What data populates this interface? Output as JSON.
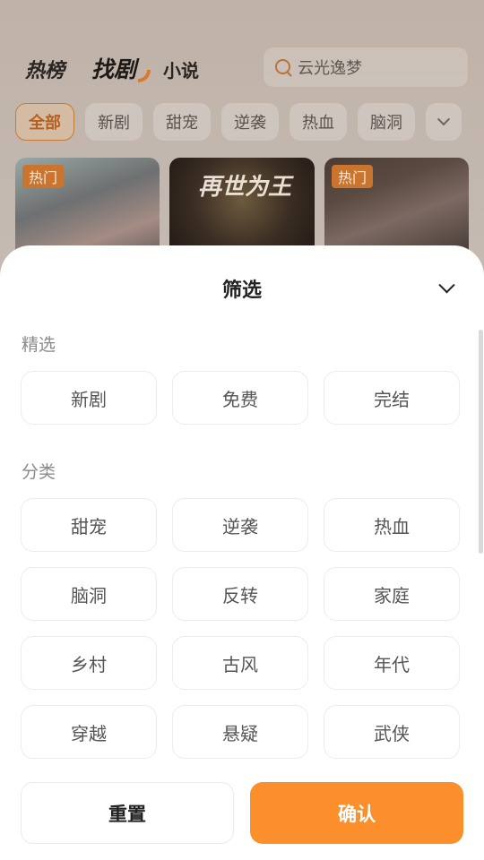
{
  "header": {
    "tabs": [
      {
        "label": "热榜"
      },
      {
        "label": "找剧"
      },
      {
        "label": "小说"
      }
    ],
    "search": {
      "placeholder": "云光逸梦"
    }
  },
  "category_chips": [
    "全部",
    "新剧",
    "甜宠",
    "逆袭",
    "热血",
    "脑洞"
  ],
  "cards": [
    {
      "badge": "热门"
    },
    {
      "title": "再世为王"
    },
    {
      "badge": "热门"
    }
  ],
  "sheet": {
    "title": "筛选",
    "sections": [
      {
        "label": "精选",
        "options": [
          "新剧",
          "免费",
          "完结"
        ]
      },
      {
        "label": "分类",
        "options": [
          "甜宠",
          "逆袭",
          "热血",
          "脑洞",
          "反转",
          "家庭",
          "乡村",
          "古风",
          "年代",
          "穿越",
          "悬疑",
          "武侠"
        ]
      }
    ],
    "reset_label": "重置",
    "confirm_label": "确认"
  },
  "colors": {
    "accent": "#fb8f2b",
    "badge": "#c9742f"
  }
}
